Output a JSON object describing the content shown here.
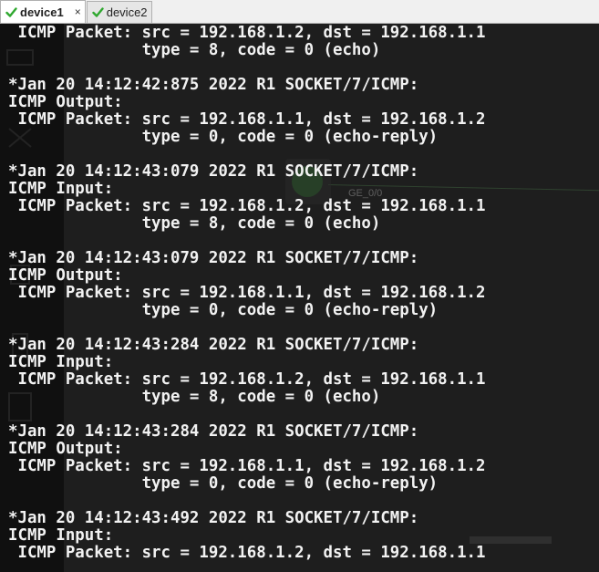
{
  "tabs": [
    {
      "label": "device1",
      "active": true,
      "status_icon": "green-check-icon",
      "closable": true
    },
    {
      "label": "device2",
      "active": false,
      "status_icon": "green-check-icon",
      "closable": false
    }
  ],
  "tab_close_glyph": "×",
  "background_labels": {
    "interface_label": "GE_0/0"
  },
  "colors": {
    "terminal_bg": "#1e1e1e",
    "terminal_text": "#f2f2f2",
    "check_green": "#2fa82f"
  },
  "terminal_lines": [
    " ICMP Packet: src = 192.168.1.2, dst = 192.168.1.1",
    "              type = 8, code = 0 (echo)",
    "",
    "*Jan 20 14:12:42:875 2022 R1 SOCKET/7/ICMP:",
    "ICMP Output:",
    " ICMP Packet: src = 192.168.1.1, dst = 192.168.1.2",
    "              type = 0, code = 0 (echo-reply)",
    "",
    "*Jan 20 14:12:43:079 2022 R1 SOCKET/7/ICMP:",
    "ICMP Input:",
    " ICMP Packet: src = 192.168.1.2, dst = 192.168.1.1",
    "              type = 8, code = 0 (echo)",
    "",
    "*Jan 20 14:12:43:079 2022 R1 SOCKET/7/ICMP:",
    "ICMP Output:",
    " ICMP Packet: src = 192.168.1.1, dst = 192.168.1.2",
    "              type = 0, code = 0 (echo-reply)",
    "",
    "*Jan 20 14:12:43:284 2022 R1 SOCKET/7/ICMP:",
    "ICMP Input:",
    " ICMP Packet: src = 192.168.1.2, dst = 192.168.1.1",
    "              type = 8, code = 0 (echo)",
    "",
    "*Jan 20 14:12:43:284 2022 R1 SOCKET/7/ICMP:",
    "ICMP Output:",
    " ICMP Packet: src = 192.168.1.1, dst = 192.168.1.2",
    "              type = 0, code = 0 (echo-reply)",
    "",
    "*Jan 20 14:12:43:492 2022 R1 SOCKET/7/ICMP:",
    "ICMP Input:",
    " ICMP Packet: src = 192.168.1.2, dst = 192.168.1.1"
  ]
}
